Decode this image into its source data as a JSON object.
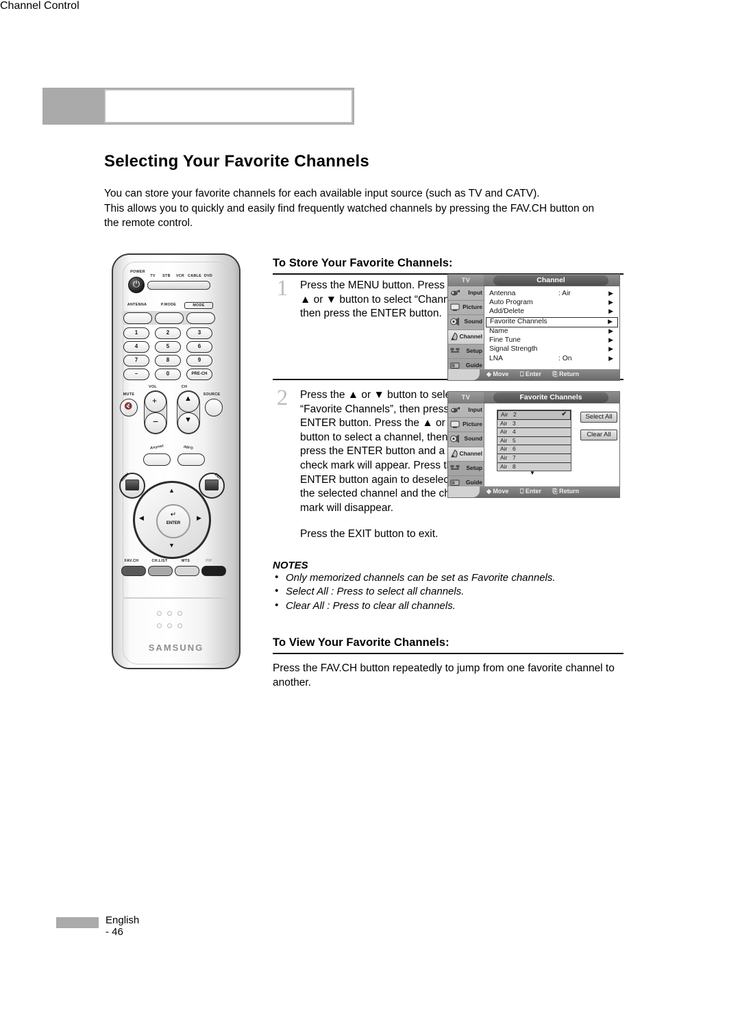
{
  "chapter": {
    "title": "Channel Control"
  },
  "section": {
    "title": "Selecting Your Favorite Channels"
  },
  "intro": {
    "line1": "You can store your favorite channels for each available input source (such as TV and CATV).",
    "line2": "This allows you to quickly and easily find frequently watched channels by pressing the FAV.CH button on",
    "line3": "the remote control."
  },
  "store": {
    "heading": "To Store Your Favorite Channels:",
    "step1_num": "1",
    "step1_text": "Press the MENU button. Press the ▲ or ▼ button to select “Channel”, then press the ENTER button.",
    "step2_num": "2",
    "step2_text": "Press the ▲ or ▼ button to select “Favorite Channels”, then press the ENTER button. Press the ▲ or ▼ button to select a channel, then press the ENTER button and a check mark will appear. Press the ENTER button again to deselect the selected channel and the check mark will disappear.",
    "step2_exit": "Press the EXIT button to exit."
  },
  "notes": {
    "title": "NOTES",
    "items": [
      "Only memorized channels can be set as Favorite channels.",
      "Select All : Press to select all channels.",
      "Clear All : Press to clear all channels."
    ]
  },
  "view": {
    "heading": "To View Your Favorite Channels:",
    "text": "Press the FAV.CH button repeatedly to jump from one favorite channel to another."
  },
  "osd_channel": {
    "source_label": "TV",
    "title": "Channel",
    "sidebar": [
      "Input",
      "Picture",
      "Sound",
      "Channel",
      "Setup",
      "Guide"
    ],
    "selected_sidebar": "Channel",
    "rows": [
      {
        "label": "Antenna",
        "value": ": Air",
        "arrow": "▶",
        "boxed": false
      },
      {
        "label": "Auto Program",
        "value": "",
        "arrow": "▶",
        "boxed": false
      },
      {
        "label": "Add/Delete",
        "value": "",
        "arrow": "▶",
        "boxed": false
      },
      {
        "label": "Favorite Channels",
        "value": "",
        "arrow": "▶",
        "boxed": true
      },
      {
        "label": "Name",
        "value": "",
        "arrow": "▶",
        "boxed": false
      },
      {
        "label": "Fine Tune",
        "value": "",
        "arrow": "▶",
        "boxed": false
      },
      {
        "label": "Signal Strength",
        "value": "",
        "arrow": "▶",
        "boxed": false
      },
      {
        "label": "LNA",
        "value": ": On",
        "arrow": "▶",
        "boxed": false
      }
    ],
    "footer": {
      "move": "Move",
      "enter": "Enter",
      "return": "Return"
    }
  },
  "osd_favorite": {
    "source_label": "TV",
    "title": "Favorite Channels",
    "sidebar": [
      "Input",
      "Picture",
      "Sound",
      "Channel",
      "Setup",
      "Guide"
    ],
    "selected_sidebar": "Channel",
    "channels": [
      {
        "band": "Air",
        "num": "2",
        "checked": true
      },
      {
        "band": "Air",
        "num": "3",
        "checked": false
      },
      {
        "band": "Air",
        "num": "4",
        "checked": false
      },
      {
        "band": "Air",
        "num": "5",
        "checked": false
      },
      {
        "band": "Air",
        "num": "6",
        "checked": false
      },
      {
        "band": "Air",
        "num": "7",
        "checked": false
      },
      {
        "band": "Air",
        "num": "8",
        "checked": false
      }
    ],
    "scroll_down": "▼",
    "check_glyph": "✔",
    "select_all": "Select All",
    "clear_all": "Clear All",
    "footer": {
      "move": "Move",
      "enter": "Enter",
      "return": "Return"
    }
  },
  "remote": {
    "power_label": "POWER",
    "mode_labels": [
      "TV",
      "STB",
      "VCR",
      "CABLE",
      "DVD"
    ],
    "antenna_label": "ANTENNA",
    "pmode_label": "P.MODE",
    "mode_label": "MODE",
    "keypad": [
      "1",
      "2",
      "3",
      "4",
      "5",
      "6",
      "7",
      "8",
      "9",
      "–",
      "0",
      "PRE-CH"
    ],
    "mute_label": "MUTE",
    "vol_label": "VOL",
    "ch_label": "CH",
    "source_label": "SOURCE",
    "anynet_label": "Anynet",
    "info_label": "INFO",
    "menu_label": "MENU",
    "exit_label": "EXIT",
    "enter_label": "ENTER",
    "bottom_buttons": [
      "FAV.CH",
      "CH.LIST",
      "MTS",
      "PIP"
    ],
    "brand": "SAMSUNG"
  },
  "footer": {
    "page": "English - 46"
  },
  "colors": {
    "grey_bar": "#aaaaaa",
    "step_number": "#bdbdbd",
    "osd_body": "#d2d2d2"
  }
}
